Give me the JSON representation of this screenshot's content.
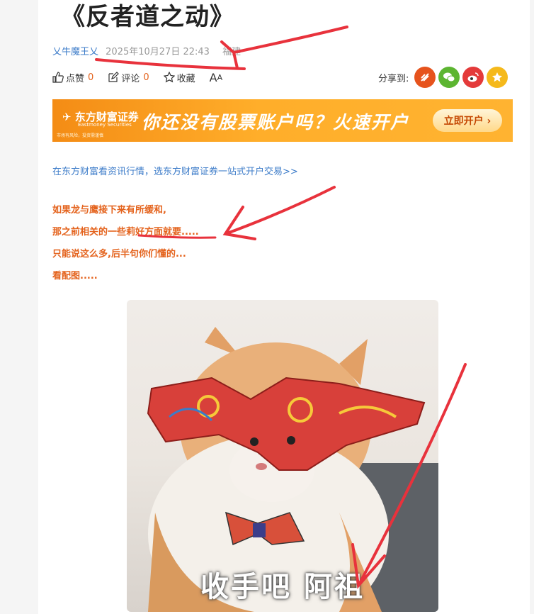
{
  "article": {
    "title": "《反者道之动》",
    "author": "乂牛魔王乂",
    "datetime": "2025年10月27日 22:43",
    "location": "福建"
  },
  "actions": {
    "like_label": "点赞",
    "like_count": "0",
    "comment_label": "评论",
    "comment_count": "0",
    "favorite_label": "收藏",
    "fontsize_label": "A",
    "fontsize_small": "A"
  },
  "share": {
    "label": "分享到:",
    "items": [
      "eastmoney",
      "wechat",
      "weibo",
      "qzone"
    ]
  },
  "banner": {
    "logo_text": "东方财富证券",
    "logo_sub": "Eastmoney Securities",
    "risk_text": "市场有风险，投资需谨慎",
    "headline": "你还没有股票账户吗？火速开户",
    "button": "立即开户 ›"
  },
  "promo_link": "在东方财富看资讯行情，选东方财富证券一站式开户交易>>",
  "body": [
    "如果龙与鹰接下来有所缓和,",
    "那之前相关的一些莉好方面就要.....",
    "只能说这么多,后半句你们懂的...",
    "看配图....."
  ],
  "image": {
    "caption": "收手吧 阿祖"
  },
  "colors": {
    "accent_orange": "#e4631d",
    "link_blue": "#3d7cc9",
    "annotation_red": "#e8323c"
  }
}
